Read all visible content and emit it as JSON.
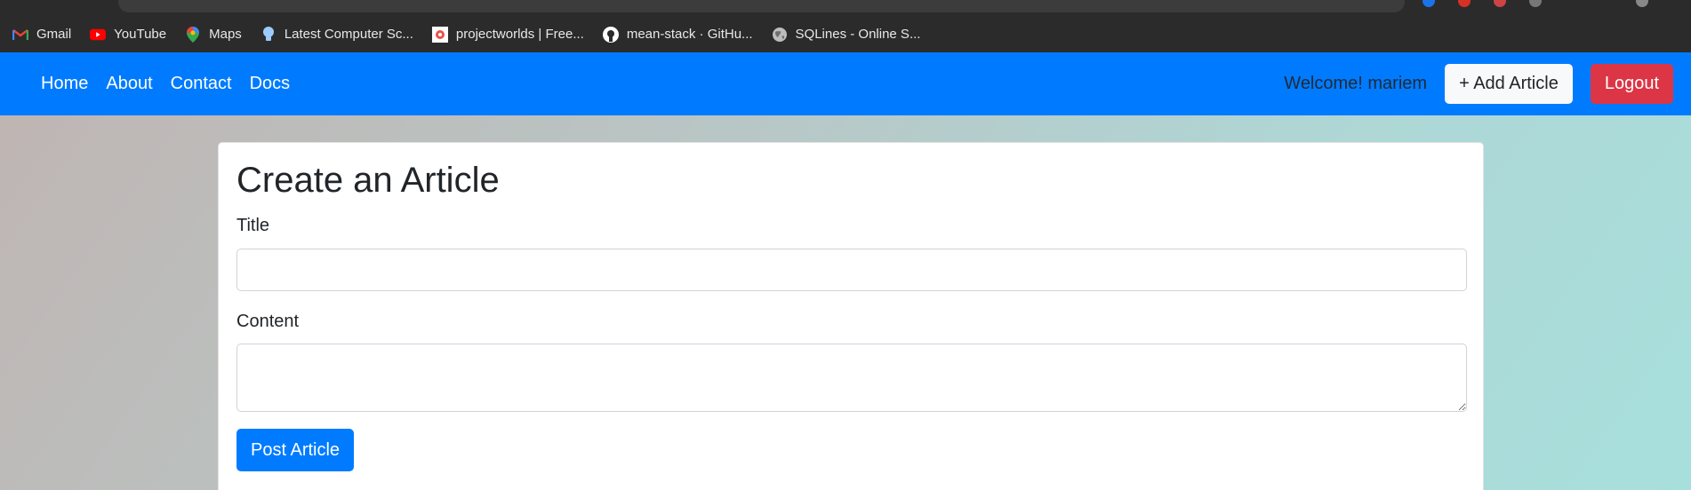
{
  "bookmarks": [
    {
      "label": "Gmail",
      "icon": "gmail-icon"
    },
    {
      "label": "YouTube",
      "icon": "youtube-icon"
    },
    {
      "label": "Maps",
      "icon": "maps-icon"
    },
    {
      "label": "Latest Computer Sc...",
      "icon": "lightbulb-icon"
    },
    {
      "label": "projectworlds | Free...",
      "icon": "projectworlds-icon"
    },
    {
      "label": "mean-stack · GitHu...",
      "icon": "github-icon"
    },
    {
      "label": "SQLines - Online S...",
      "icon": "globe-icon"
    }
  ],
  "nav": {
    "links": [
      "Home",
      "About",
      "Contact",
      "Docs"
    ],
    "welcome": "Welcome! mariem",
    "add_article": "+ Add Article",
    "logout": "Logout"
  },
  "form": {
    "heading": "Create an Article",
    "title_label": "Title",
    "title_value": "",
    "content_label": "Content",
    "content_value": "",
    "submit": "Post Article"
  },
  "colors": {
    "navbar": "#007bff",
    "danger": "#dc3545",
    "primary": "#007bff",
    "bookmarks_bar": "#2b2b2b"
  }
}
